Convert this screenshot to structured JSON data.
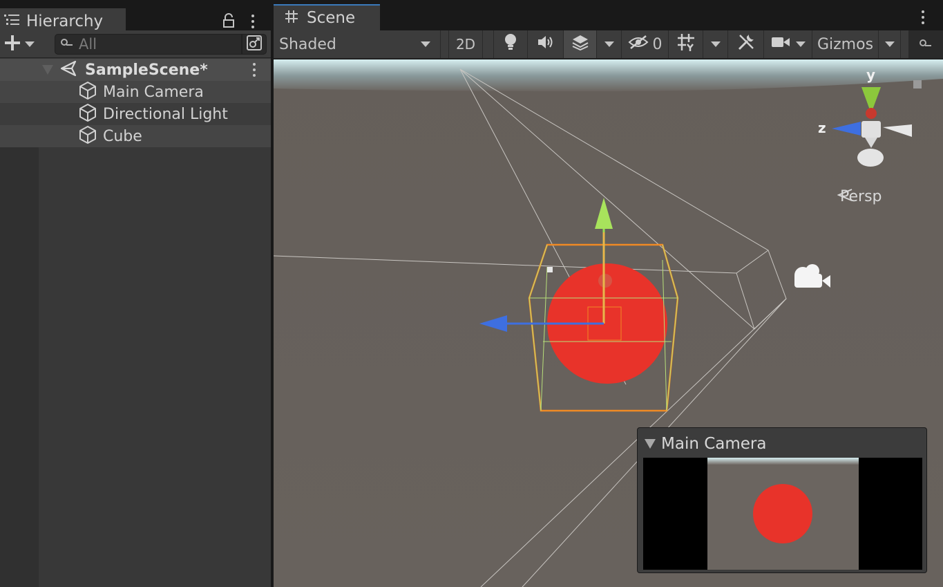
{
  "hierarchy": {
    "tab_label": "Hierarchy",
    "search_placeholder": "All",
    "scene_name": "SampleScene*",
    "items": [
      {
        "label": "Main Camera"
      },
      {
        "label": "Directional Light"
      },
      {
        "label": "Cube"
      }
    ]
  },
  "scene": {
    "tab_label": "Scene",
    "toolbar": {
      "draw_mode": "Shaded",
      "mode_2d": "2D",
      "hidden_count": "0",
      "gizmos": "Gizmos"
    },
    "view_mode": "Persp",
    "axes": {
      "y": "y",
      "z": "z"
    },
    "camera_preview": {
      "title": "Main Camera"
    }
  },
  "colors": {
    "accent": "#3a79bb",
    "sphere": "#e8332a",
    "selection": "#f08a24",
    "axis_y": "#9be050",
    "axis_z": "#3e6fe0"
  },
  "icons": [
    "hierarchy-list-icon",
    "lock-icon",
    "plus-icon",
    "search-icon",
    "search-toggle-icon",
    "unity-scene-icon",
    "gameobject-cube-icon",
    "grid-icon",
    "light-icon",
    "audio-icon",
    "effects-icon",
    "visibility-icon",
    "grid-snap-icon",
    "tools-icon",
    "camera-icon",
    "camera-gizmo-icon"
  ]
}
